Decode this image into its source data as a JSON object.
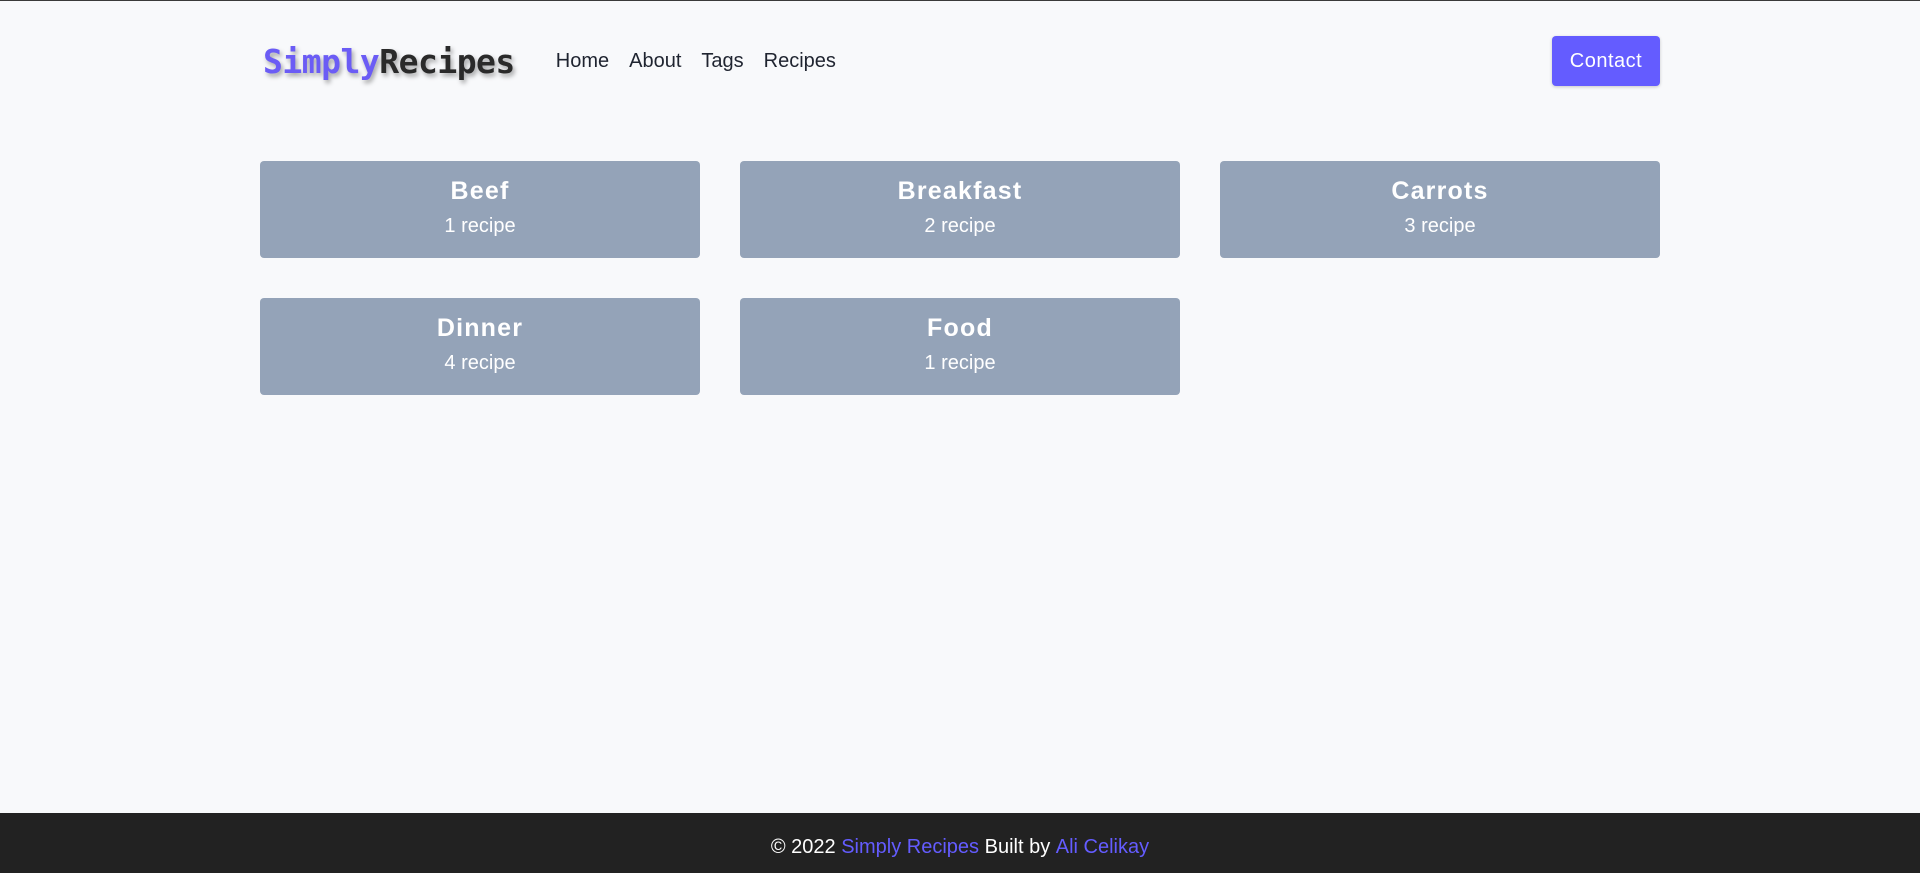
{
  "brand": {
    "part1": "Simply",
    "part2": "Recipes",
    "accent_color": "#645cff"
  },
  "nav": {
    "links": [
      {
        "label": "Home"
      },
      {
        "label": "About"
      },
      {
        "label": "Tags"
      },
      {
        "label": "Recipes"
      }
    ],
    "contact_label": "Contact"
  },
  "tags": [
    {
      "name": "Beef",
      "count": "1 recipe"
    },
    {
      "name": "Breakfast",
      "count": "2 recipe"
    },
    {
      "name": "Carrots",
      "count": "3 recipe"
    },
    {
      "name": "Dinner",
      "count": "4 recipe"
    },
    {
      "name": "Food",
      "count": "1 recipe"
    }
  ],
  "footer": {
    "copyright": "© 2022 ",
    "site_name": "Simply Recipes",
    "built_by": " Built by ",
    "author": "Ali Celikay"
  },
  "colors": {
    "card_bg": "#94a3b8",
    "footer_bg": "#222222",
    "page_bg": "#f8f9fb"
  }
}
